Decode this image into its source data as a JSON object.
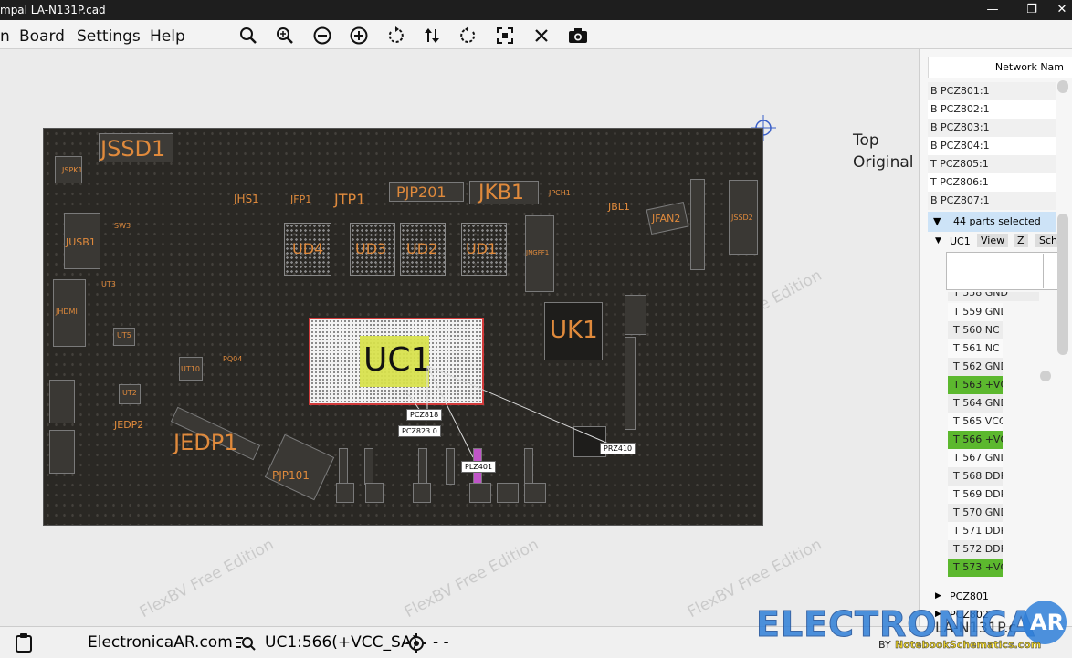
{
  "window": {
    "title": "mpal LA-N131P.cad",
    "min": "—",
    "max": "❐",
    "close": "✕"
  },
  "menu": [
    "n",
    "Board",
    "Settings",
    "Help"
  ],
  "toolbar": [
    "zoom-out-icon",
    "zoom-in-icon",
    "minus-circle-icon",
    "plus-circle-icon",
    "rotate-ccw-icon",
    "flip-icon",
    "rotate-cw-icon",
    "fit-icon",
    "clear-icon",
    "camera-icon"
  ],
  "side_labels": {
    "top": "Top",
    "original": "Original"
  },
  "board": {
    "labels": [
      "JSSD1",
      "JSPK1",
      "JHS1",
      "JFP1",
      "JTP1",
      "PJP201",
      "JKB1",
      "JPCH1",
      "JBL1",
      "JFAN2",
      "JSSD2",
      "JUSB1",
      "SW3",
      "UD4",
      "UD3",
      "UD2",
      "UD1",
      "JNGFF1",
      "UT3",
      "JHDMI",
      "UT5",
      "UT10",
      "UT2",
      "PQ04",
      "JEDP2",
      "JEDP1",
      "PJP101",
      "UK1",
      "UC1"
    ],
    "callouts": [
      "PCZ818",
      "PCZ823 0",
      "PRZ410",
      "PLZ401"
    ]
  },
  "watermark": "FlexBV Free Edition",
  "right_panel": {
    "network_header": "Network Nam",
    "nets": [
      "B PCZ801:1",
      "B PCZ802:1",
      "B PCZ803:1",
      "B PCZ804:1",
      "T  PCZ805:1",
      "T  PCZ806:1",
      "B PCZ807:1"
    ],
    "selected": "44 parts selected",
    "part": "UC1",
    "buttons": [
      "View",
      "Z",
      "Sch"
    ],
    "pins": [
      "T  558  GND",
      "T  559  GND",
      "T  560  NC",
      "T  561  NC",
      "T  562  GND",
      "T  563  +VC",
      "T  564  GND",
      "T  565  VCC",
      "T  566  +VC",
      "T  567  GND",
      "T  568  DDR",
      "T  569  DDR",
      "T  570  GND",
      "T  571  DDR",
      "T  572  DDR",
      "T  573  +VC"
    ],
    "highlight_pins": [
      5,
      8,
      15
    ],
    "highlight_color": "#5cb82e",
    "trees": [
      "PCZ801",
      "PCZ802"
    ]
  },
  "status": {
    "site": "ElectronicaAR.com",
    "net": "UC1:566(+VCC_SA)",
    "coords": "- -"
  },
  "logo": {
    "brand": "ELECTRONICA",
    "ar": "AR",
    "by": "BY",
    "sub": "NotebookSchematics.com",
    "tail": "LA-N131P.c"
  }
}
